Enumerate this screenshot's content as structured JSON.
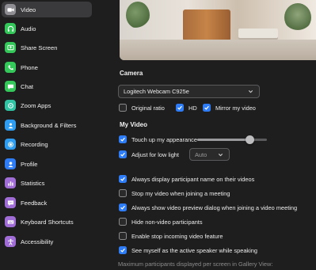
{
  "sidebar": {
    "items": [
      {
        "label": "Video",
        "icon": "video-icon",
        "color": "#8e8e93",
        "active": true
      },
      {
        "label": "Audio",
        "icon": "headphones-icon",
        "color": "#34c759"
      },
      {
        "label": "Share Screen",
        "icon": "share-screen-icon",
        "color": "#34c759"
      },
      {
        "label": "Phone",
        "icon": "phone-icon",
        "color": "#34c759"
      },
      {
        "label": "Chat",
        "icon": "chat-icon",
        "color": "#34c759"
      },
      {
        "label": "Zoom Apps",
        "icon": "apps-icon",
        "color": "#30c4a4"
      },
      {
        "label": "Background & Filters",
        "icon": "person-icon",
        "color": "#2e9cf0"
      },
      {
        "label": "Recording",
        "icon": "record-icon",
        "color": "#2e9cf0"
      },
      {
        "label": "Profile",
        "icon": "profile-icon",
        "color": "#2e7cf6"
      },
      {
        "label": "Statistics",
        "icon": "statistics-icon",
        "color": "#a06cd5"
      },
      {
        "label": "Feedback",
        "icon": "feedback-icon",
        "color": "#a06cd5"
      },
      {
        "label": "Keyboard Shortcuts",
        "icon": "keyboard-icon",
        "color": "#a06cd5"
      },
      {
        "label": "Accessibility",
        "icon": "accessibility-icon",
        "color": "#a06cd5"
      }
    ]
  },
  "camera": {
    "heading": "Camera",
    "selected": "Logitech Webcam C925e",
    "options": [
      {
        "label": "Original ratio",
        "checked": false
      },
      {
        "label": "HD",
        "checked": true
      },
      {
        "label": "Mirror my video",
        "checked": true
      }
    ]
  },
  "my_video": {
    "heading": "My Video",
    "touch_up": {
      "label": "Touch up my appearance",
      "checked": true,
      "level": 0.75
    },
    "low_light": {
      "label": "Adjust for low light",
      "checked": true,
      "mode": "Auto"
    }
  },
  "options": [
    {
      "label": "Always display participant name on their videos",
      "checked": true
    },
    {
      "label": "Stop my video when joining a meeting",
      "checked": false
    },
    {
      "label": "Always show video preview dialog when joining a video meeting",
      "checked": true
    },
    {
      "label": "Hide non-video participants",
      "checked": false
    },
    {
      "label": "Enable stop incoming video feature",
      "checked": false
    },
    {
      "label": "See myself as the active speaker while speaking",
      "checked": true
    }
  ],
  "gallery_note": "Maximum participants displayed per screen in Gallery View:",
  "colors": {
    "accent": "#2e7cf6",
    "background": "#1e1e1e",
    "active_item": "#3a3a3c"
  }
}
